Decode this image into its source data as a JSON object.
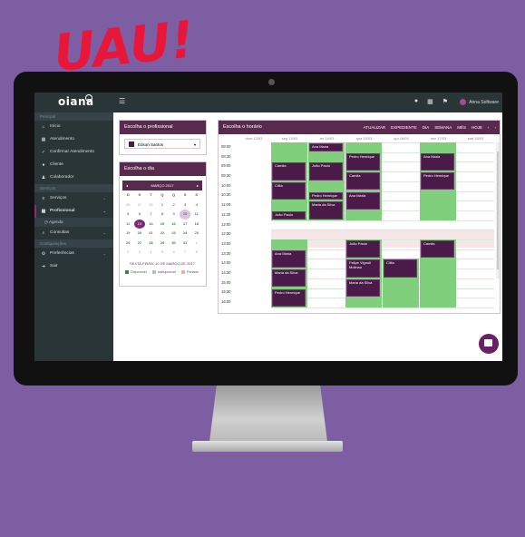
{
  "headline": "UAU!",
  "colors": {
    "background": "#7d5ea3",
    "headline": "#e8173a",
    "brand": "#5a2a4e",
    "available": "#7fcf7d",
    "appointment": "#4a1a48"
  },
  "app": {
    "logo": "oiana",
    "user": "Anna Software",
    "toolbar_icons": [
      "bell-icon",
      "calendar-icon",
      "flag-icon"
    ]
  },
  "sidebar": {
    "section1": "Principal",
    "items1": [
      {
        "label": "Início",
        "icon": "home-icon"
      },
      {
        "label": "Atendimento",
        "icon": "calendar-icon"
      },
      {
        "label": "Confirmar Atendimento",
        "icon": "check-icon"
      },
      {
        "label": "Cliente",
        "icon": "user-icon"
      },
      {
        "label": "Colaborador",
        "icon": "users-icon"
      }
    ],
    "section2": "Serviços",
    "items2": [
      {
        "label": "Serviços",
        "icon": "list-icon"
      },
      {
        "label": "Profissional",
        "icon": "calendar-icon"
      }
    ],
    "sub": "Agenda",
    "items3": [
      {
        "label": "Consultas",
        "icon": "search-icon"
      }
    ],
    "section3": "Configurações",
    "items4": [
      {
        "label": "Preferências",
        "icon": "gear-icon"
      },
      {
        "label": "Sair",
        "icon": "exit-icon"
      }
    ]
  },
  "prof": {
    "title": "Escolha o profissional",
    "selected": "Edson Santos"
  },
  "dia": {
    "title": "Escolha o dia",
    "month": "MARÇO 2017",
    "dows": [
      "D",
      "S",
      "T",
      "Q",
      "Q",
      "S",
      "S"
    ],
    "weeks": [
      [
        "26",
        "27",
        "28",
        "1",
        "2",
        "3",
        "4"
      ],
      [
        "5",
        "6",
        "7",
        "8",
        "9",
        "10",
        "11"
      ],
      [
        "12",
        "13",
        "14",
        "15",
        "16",
        "17",
        "18"
      ],
      [
        "19",
        "20",
        "21",
        "22",
        "23",
        "24",
        "25"
      ],
      [
        "26",
        "27",
        "28",
        "29",
        "30",
        "31",
        "1"
      ],
      [
        "2",
        "3",
        "4",
        "5",
        "6",
        "7",
        "8"
      ]
    ],
    "footer": "SEXTA-FEIRA, 10 DE MARÇO DE 2017",
    "legend": [
      "Disponível",
      "Indisponível",
      "Feriado"
    ]
  },
  "horario": {
    "title": "Escolha o horário",
    "tools": [
      "ATUALIZAR",
      "EXPEDIENTE",
      "DIA",
      "SEMANA",
      "MÊS",
      "HOJE",
      "‹",
      "›"
    ],
    "days": [
      "dom 12/03",
      "seg 13/03",
      "ter 14/03",
      "qua 15/03",
      "qui 16/03",
      "sex 17/03",
      "sáb 18/03"
    ],
    "times": [
      "08:00",
      "08:30",
      "09:00",
      "09:30",
      "10:00",
      "10:30",
      "11:00",
      "11:30",
      "12:00",
      "12:30",
      "13:00",
      "13:30",
      "14:00",
      "14:30",
      "15:00",
      "15:30",
      "16:00"
    ],
    "appts": [
      {
        "day": 1,
        "start": 2,
        "len": 2,
        "name": "Camila"
      },
      {
        "day": 1,
        "start": 4,
        "len": 2,
        "name": "Cilila"
      },
      {
        "day": 1,
        "start": 7,
        "len": 1,
        "name": "João Paulo"
      },
      {
        "day": 1,
        "start": 11,
        "len": 2,
        "name": "Ana Maria"
      },
      {
        "day": 1,
        "start": 13,
        "len": 2,
        "name": "Maria da Silva"
      },
      {
        "day": 1,
        "start": 15,
        "len": 2,
        "name": "Pedro Henrique"
      },
      {
        "day": 2,
        "start": 0,
        "len": 1,
        "name": "Ana Maria"
      },
      {
        "day": 2,
        "start": 2,
        "len": 2,
        "name": "João Paulo"
      },
      {
        "day": 2,
        "start": 5,
        "len": 1,
        "name": "Pedro Henrique"
      },
      {
        "day": 2,
        "start": 6,
        "len": 2,
        "name": "Maria da Silva"
      },
      {
        "day": 3,
        "start": 1,
        "len": 2,
        "name": "Pedro Henrique"
      },
      {
        "day": 3,
        "start": 3,
        "len": 2,
        "name": "Camila"
      },
      {
        "day": 3,
        "start": 5,
        "len": 2,
        "name": "Ana Maria"
      },
      {
        "day": 3,
        "start": 10,
        "len": 2,
        "name": "João Paulo"
      },
      {
        "day": 3,
        "start": 12,
        "len": 2,
        "name": "Felipe Vignoli Molinau"
      },
      {
        "day": 3,
        "start": 14,
        "len": 2,
        "name": "Maria da Silva"
      },
      {
        "day": 4,
        "start": 12,
        "len": 2,
        "name": "Cilila"
      },
      {
        "day": 5,
        "start": 1,
        "len": 2,
        "name": "Ana Maria"
      },
      {
        "day": 5,
        "start": 3,
        "len": 2,
        "name": "Pedro Henrique"
      },
      {
        "day": 5,
        "start": 10,
        "len": 2,
        "name": "Camila"
      }
    ],
    "avail": [
      {
        "day": 1,
        "start": 0,
        "end": 8
      },
      {
        "day": 1,
        "start": 10,
        "end": 17
      },
      {
        "day": 2,
        "start": 0,
        "end": 8
      },
      {
        "day": 3,
        "start": 0,
        "end": 8
      },
      {
        "day": 3,
        "start": 10,
        "end": 17
      },
      {
        "day": 4,
        "start": 12,
        "end": 17
      },
      {
        "day": 5,
        "start": 0,
        "end": 8
      },
      {
        "day": 5,
        "start": 10,
        "end": 17
      }
    ]
  }
}
